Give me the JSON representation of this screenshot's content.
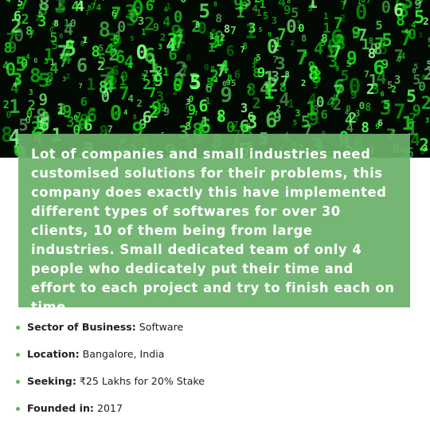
{
  "hero": {
    "image": "matrix-digits-background",
    "accent": "#4cff4c"
  },
  "card": {
    "background": "#6aaf6a",
    "description": "Lot of companies and small industries need customised solutions for their problems, this company does exactly this have implemented different types of softwares for over 30 clients, 10 of them being from large industries. Small dedicated team of only 4 people who dedicately put their time and effort to each project and try to finish each on time..."
  },
  "details": [
    {
      "label": "Sector of Business:",
      "value": "Software"
    },
    {
      "label": "Location:",
      "value": "Bangalore, India"
    },
    {
      "label": "Seeking:",
      "value": "₹25 Lakhs for 20% Stake"
    },
    {
      "label": "Founded in:",
      "value": "2017"
    }
  ]
}
